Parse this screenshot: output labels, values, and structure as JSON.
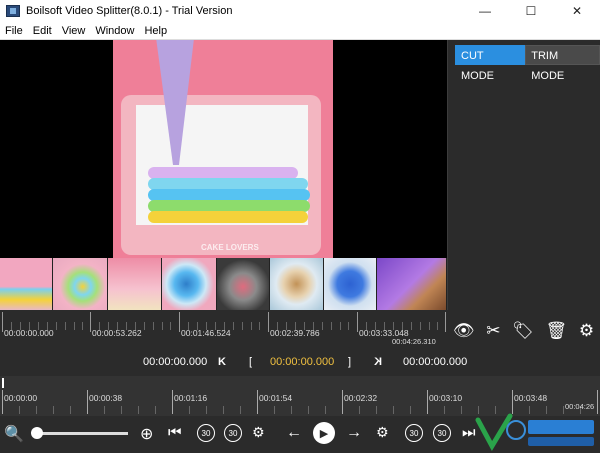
{
  "window": {
    "title": "Boilsoft Video Splitter(8.0.1) - Trial Version"
  },
  "menu": [
    "File",
    "Edit",
    "View",
    "Window",
    "Help"
  ],
  "video": {
    "watermark": "CAKE LOVERS"
  },
  "modes": {
    "cut": "CUT MODE",
    "trim": "TRIM MODE",
    "active": "cut"
  },
  "ruler_top": {
    "labels": [
      "00:00:00.000",
      "00:00:53.262",
      "00:01:46.524",
      "00:02:39.786",
      "00:03:33.048"
    ],
    "end": "00:04:26.310"
  },
  "timecodes": {
    "current": "00:00:00.000",
    "start_bracket": "[",
    "selection": "00:00:00.000",
    "end_bracket": "]",
    "prev_marker": "K",
    "next_marker": "K"
  },
  "timeline": {
    "labels": [
      "00:00:00",
      "00:00:38",
      "00:01:16",
      "00:01:54",
      "00:02:32",
      "00:03:10",
      "00:03:48"
    ],
    "end": "00:04:26"
  },
  "controls": {
    "back30": "30",
    "fwd30": "30"
  },
  "colors": {
    "accent": "#2b8fe0",
    "selection_time": "#f0c040"
  }
}
